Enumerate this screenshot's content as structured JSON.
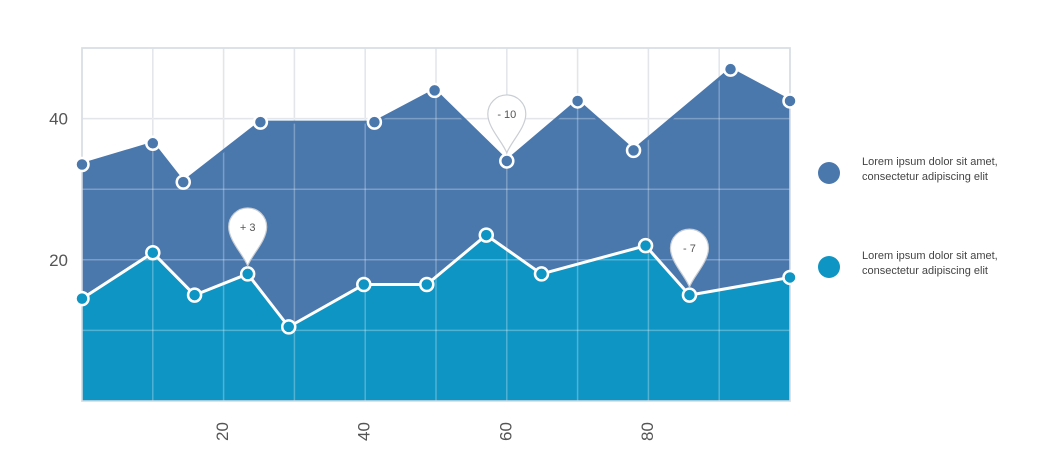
{
  "colors": {
    "series_top": "#4a78ad",
    "series_bottom": "#0e95c4",
    "grid": "#d7dde4",
    "axis_text": "#555555"
  },
  "legend": {
    "items": [
      {
        "text": "Lorem ipsum dolor sit amet, consectetur adipiscing elit",
        "color": "#4a78ad"
      },
      {
        "text": "Lorem ipsum dolor sit amet, consectetur adipiscing elit",
        "color": "#0e95c4"
      }
    ]
  },
  "chart_data": {
    "type": "area",
    "xlim": [
      0,
      100
    ],
    "ylim": [
      0,
      50
    ],
    "xticks": [
      20,
      40,
      60,
      80
    ],
    "xtick_labels": [
      "20",
      "40",
      "60",
      "80"
    ],
    "yticks": [
      20,
      40
    ],
    "ytick_labels": [
      "20",
      "40"
    ],
    "grid": true,
    "legend_position": "right",
    "series": [
      {
        "color": "#4a78ad",
        "x": [
          0,
          10,
          14.3,
          25.2,
          41.3,
          49.8,
          60,
          70,
          77.9,
          91.6,
          100
        ],
        "y": [
          33.5,
          36.5,
          31,
          39.5,
          39.5,
          44,
          34,
          42.5,
          35.5,
          47,
          42.5
        ]
      },
      {
        "color": "#0e95c4",
        "x": [
          0,
          10,
          15.9,
          23.4,
          29.2,
          39.8,
          48.7,
          57.1,
          64.9,
          79.6,
          85.8,
          100
        ],
        "y": [
          14.5,
          21,
          15,
          18,
          10.5,
          16.5,
          16.5,
          23.5,
          18,
          22,
          15,
          17.5
        ]
      }
    ],
    "annotations": [
      {
        "text": "- 10",
        "series": 0,
        "point": 6
      },
      {
        "text": "+ 3",
        "series": 1,
        "point": 3
      },
      {
        "text": "- 7",
        "series": 1,
        "point": 10
      }
    ]
  }
}
